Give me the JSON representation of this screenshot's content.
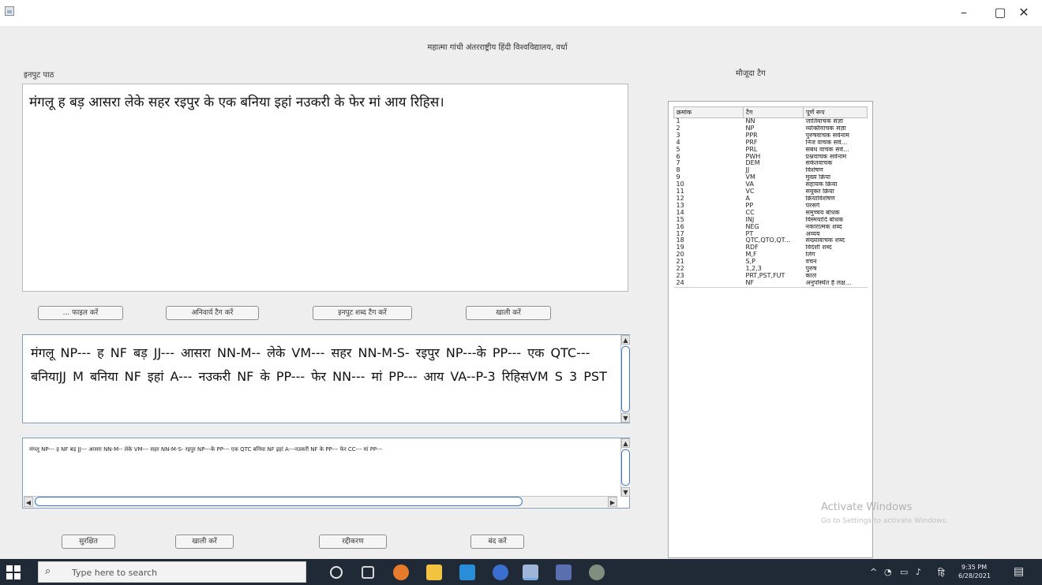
{
  "window": {
    "minimize_glyph": "–",
    "maximize_glyph": "▢",
    "close_glyph": "✕",
    "app_title": "महात्मा गांधी अंतरराष्ट्रीय हिंदी विश्वविद्यालय, वर्धा"
  },
  "input": {
    "label": "इनपुट पाठ",
    "text": "मंगलू ह बड़ आसरा लेके सहर रइपुर के एक बनिया इहां नउकरी के फेर मां आय रिहिस।"
  },
  "buttons_top": {
    "load": "... फाइल करें",
    "tag_manual": "अनिवार्य टैग करें",
    "tag_auto": "इनपुट शब्द टैग करें",
    "clear": "खाली करें"
  },
  "tagged_output": {
    "text": "मंगलू NP--- ह NF बड़ JJ--- आसरा NN-M-- लेके VM--- सहर NN-M-S- रइपुर NP---के PP--- एक QTC--- बनियाJJ M बनिया NF इहां A--- नउकरी NF के PP--- फेर NN--- मां PP--- आय VA--P-3 रिहिसVM S 3 PST"
  },
  "lower_output": {
    "text": "मंगलू NP--- ह NF बड़ JJ--- आसरा NN-M-- लेके VM--- सहर NN-M-S- रइपुर NP---के PP--- एक QTC बनिया NF इहां A---नउकरी NF के PP--- फेर CC--- मां PP---"
  },
  "buttons_bottom": {
    "save": "सुरक्षित",
    "clear": "खाली करें",
    "reset": "रद्दीकरण",
    "close": "बंद करें"
  },
  "tags_panel": {
    "label": "मौजूदा टैग",
    "headers": [
      "क्रमांक",
      "टैग",
      "पूर्ण रूप"
    ],
    "rows": [
      [
        "1",
        "NN",
        "जातिवाचक संज्ञा"
      ],
      [
        "2",
        "NP",
        "व्यक्तिवाचक संज्ञा"
      ],
      [
        "3",
        "PPR",
        "पुरुषवाचक सर्वनाम"
      ],
      [
        "4",
        "PRF",
        "निज वाचक सर्व..."
      ],
      [
        "5",
        "PRL",
        "संबंध वाचक सर्व..."
      ],
      [
        "6",
        "PWH",
        "प्रश्नवाचक सर्वनाम"
      ],
      [
        "7",
        "DEM",
        "संकेतवाचक"
      ],
      [
        "8",
        "JJ",
        "विशेषण"
      ],
      [
        "9",
        "VM",
        "मुख्य क्रिया"
      ],
      [
        "10",
        "VA",
        "सहायक क्रिया"
      ],
      [
        "11",
        "VC",
        "संयुक्त क्रिया"
      ],
      [
        "12",
        "A",
        "क्रियाविशेषण"
      ],
      [
        "13",
        "PP",
        "परसर्ग"
      ],
      [
        "14",
        "CC",
        "समुच्चय बोधक"
      ],
      [
        "15",
        "INJ",
        "विस्मयादि बोधक"
      ],
      [
        "16",
        "NEG",
        "नकारात्मक शब्द"
      ],
      [
        "17",
        "PT",
        "अव्यय"
      ],
      [
        "18",
        "QTC,QTO,QT...",
        "संख्यावाचक शब्द"
      ],
      [
        "19",
        "RDF",
        "विदेशी शब्द"
      ],
      [
        "20",
        "M,F",
        "लिंग"
      ],
      [
        "21",
        "S,P",
        "वचन"
      ],
      [
        "22",
        "1,2,3",
        "पुरुष"
      ],
      [
        "23",
        "PRT,PST,FUT",
        "काल"
      ],
      [
        "24",
        "NF",
        "अनुपस्थित है लक्ष..."
      ]
    ]
  },
  "watermark": {
    "title": "Activate Windows",
    "subtitle": "Go to Settings to activate Windows."
  },
  "taskbar": {
    "search_placeholder": "Type here to search",
    "time": "9:35 PM",
    "date": "6/28/2021",
    "lang": "हि"
  },
  "colors": {
    "taskbar_bg": "#1f2a36",
    "window_bg": "#eeeeee",
    "scroll_accent": "#3c78c8"
  }
}
